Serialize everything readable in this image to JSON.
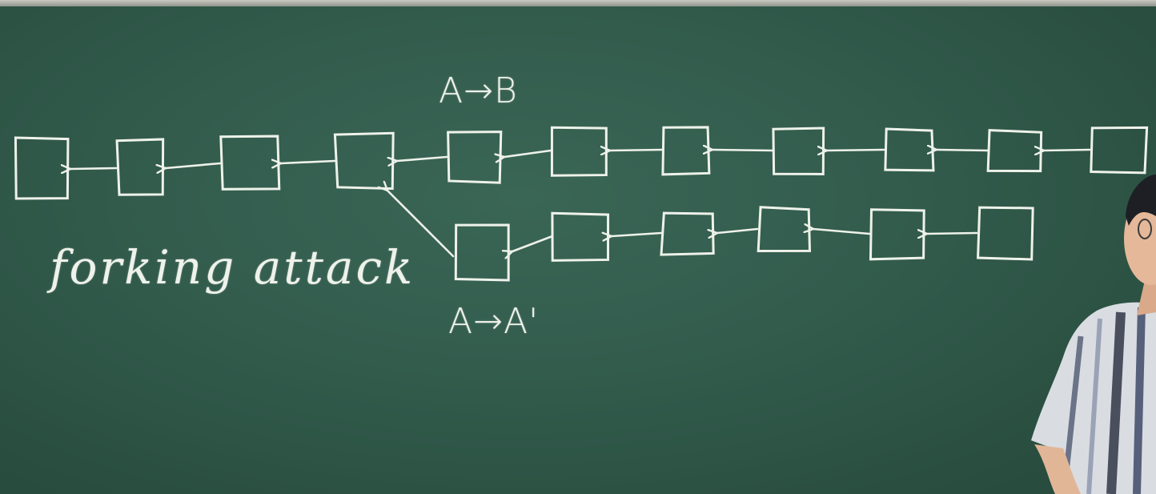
{
  "labels": {
    "main_chain_tx": "A→B",
    "fork_chain_tx": "A→A'",
    "topic": "forking attack"
  },
  "diagram": {
    "main_chain_block_count": 11,
    "fork_chain_block_count": 6,
    "fork_point_block": 4
  },
  "colors": {
    "board": "#325b4c",
    "chalk": "#eef2ea"
  }
}
